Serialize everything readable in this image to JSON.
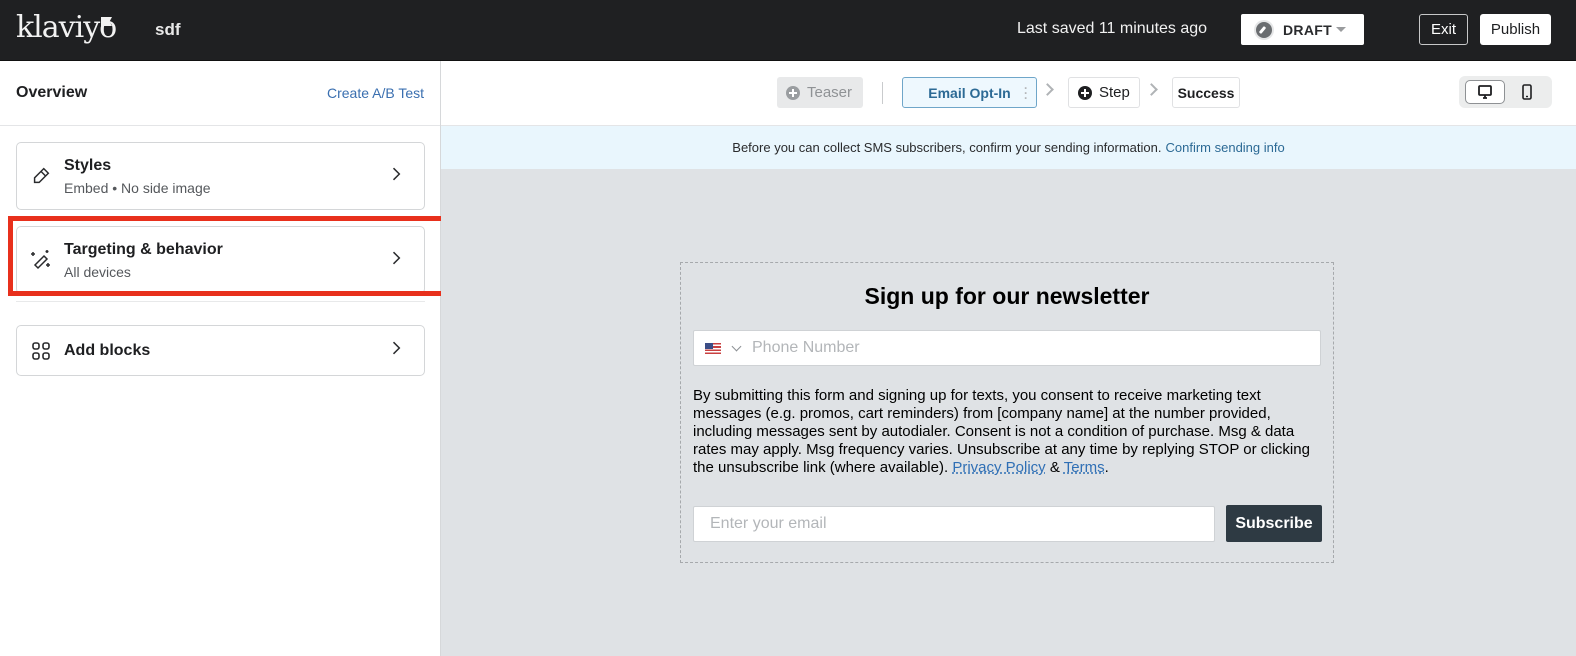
{
  "app": {
    "logo": "klaviyo",
    "form_name": "sdf"
  },
  "header": {
    "last_saved": "Last saved 11 minutes ago",
    "status": "DRAFT",
    "exit_label": "Exit",
    "publish_label": "Publish"
  },
  "sidebar": {
    "title": "Overview",
    "ab_test_link": "Create A/B Test",
    "cards": [
      {
        "title": "Styles",
        "subtitle": "Embed • No side image",
        "icon": "pencil-icon"
      },
      {
        "title": "Targeting & behavior",
        "subtitle": "All devices",
        "icon": "magic-wand-icon",
        "highlighted": true
      },
      {
        "title": "Add blocks",
        "icon": "grid-icon"
      }
    ]
  },
  "steps": {
    "teaser": "Teaser",
    "email_optin": "Email Opt-In",
    "step": "Step",
    "success": "Success"
  },
  "device_toggle": {
    "selected": "desktop",
    "options": [
      "desktop",
      "mobile"
    ]
  },
  "banner": {
    "text": "Before you can collect SMS subscribers, confirm your sending information.",
    "link": "Confirm sending info"
  },
  "form": {
    "title": "Sign up for our newsletter",
    "phone_country": "US",
    "phone_placeholder": "Phone Number",
    "consent_text": "By submitting this form and signing up for texts, you consent to receive marketing text messages (e.g. promos, cart reminders) from [company name] at the number provided, including messages sent by autodialer. Consent is not a condition of purchase. Msg & data rates may apply. Msg frequency varies. Unsubscribe at any time by replying STOP or clicking the unsubscribe link (where available). ",
    "privacy_link": "Privacy Policy",
    "amp": " & ",
    "terms_link": "Terms",
    "period": ".",
    "email_placeholder": "Enter your email",
    "subscribe_label": "Subscribe"
  },
  "colors": {
    "topbar": "#1f2022",
    "link": "#3a6fb0",
    "highlight": "#e8301c",
    "subscribe_button": "#2e3a43",
    "canvas": "#dfe2e5"
  }
}
